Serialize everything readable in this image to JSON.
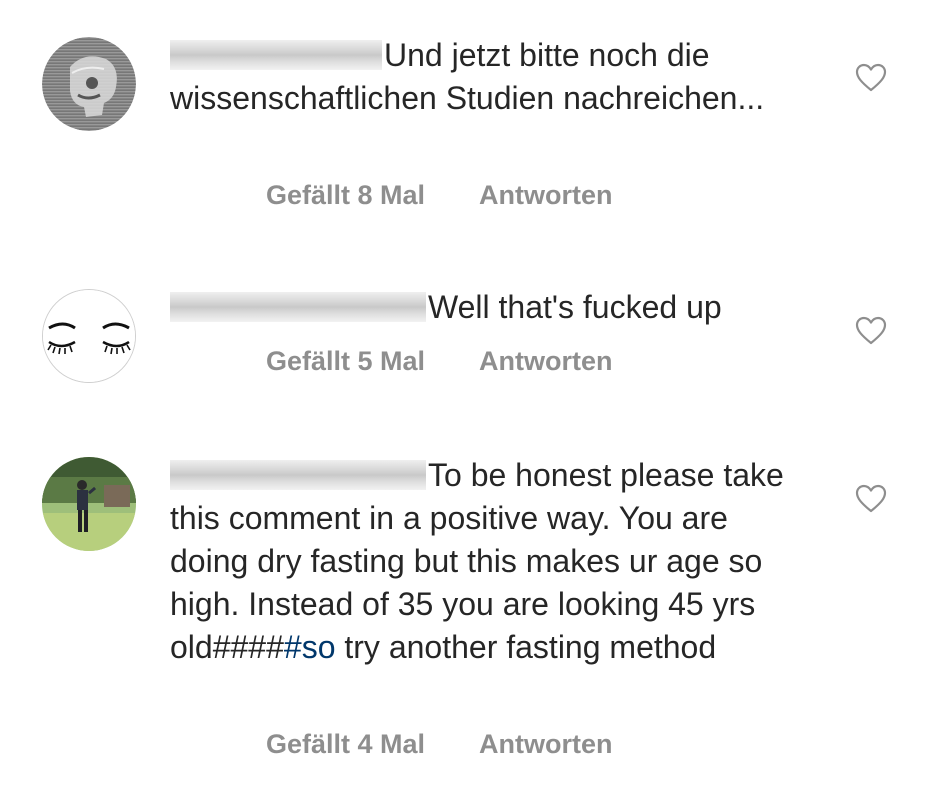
{
  "comments": [
    {
      "text": "Und jetzt bitte noch die wissenschaftlichen Studien nachreichen...",
      "likes_label": "Gefällt 8 Mal",
      "reply_label": "Antworten",
      "avatar": "skull-xray-avatar"
    },
    {
      "text": "Well that's fucked up",
      "likes_label": "Gefällt 5 Mal",
      "reply_label": "Antworten",
      "avatar": "eyelashes-avatar"
    },
    {
      "text_before": "To be honest please take this comment in a positive way. You are doing dry fasting but this makes ur age so high. Instead of 35 you are looking 45 yrs old####",
      "hashtag": "#so",
      "text_after": " try another fasting method",
      "likes_label": "Gefällt 4 Mal",
      "reply_label": "Antworten",
      "avatar": "person-outdoors-avatar"
    }
  ],
  "icons": {
    "like": "heart-outline-icon"
  },
  "colors": {
    "text": "#262626",
    "meta": "#8e8e8e",
    "hashtag": "#00376b"
  }
}
